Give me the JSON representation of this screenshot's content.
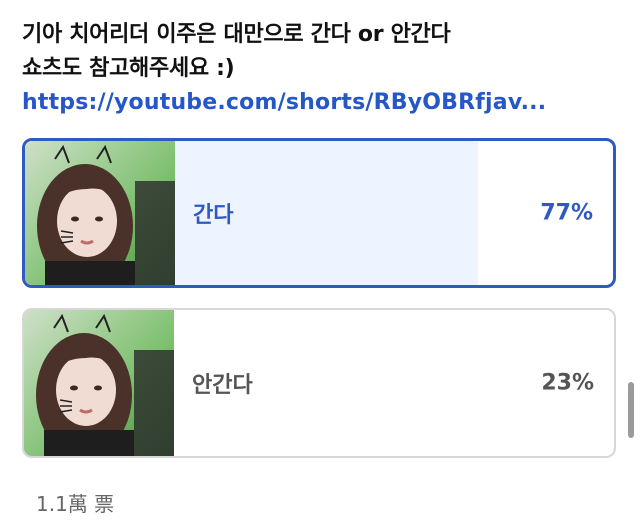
{
  "post": {
    "line1": "기아 치어리더 이주은 대만으로 간다 or 안간다",
    "line2": "쇼츠도 참고해주세요 :)",
    "link": "https://youtube.com/shorts/RByOBRfjav..."
  },
  "poll": {
    "options": [
      {
        "label": "간다",
        "percent": "77%",
        "fraction": 0.77,
        "selected": true
      },
      {
        "label": "안간다",
        "percent": "23%",
        "fraction": 0.23,
        "selected": false
      }
    ],
    "vote_count": "1.1萬 票"
  },
  "colors": {
    "accent": "#2f5ac2",
    "link": "#2657c6",
    "selected_fill": "#eef4ff",
    "unselected_fill": "#e4e4e4"
  }
}
